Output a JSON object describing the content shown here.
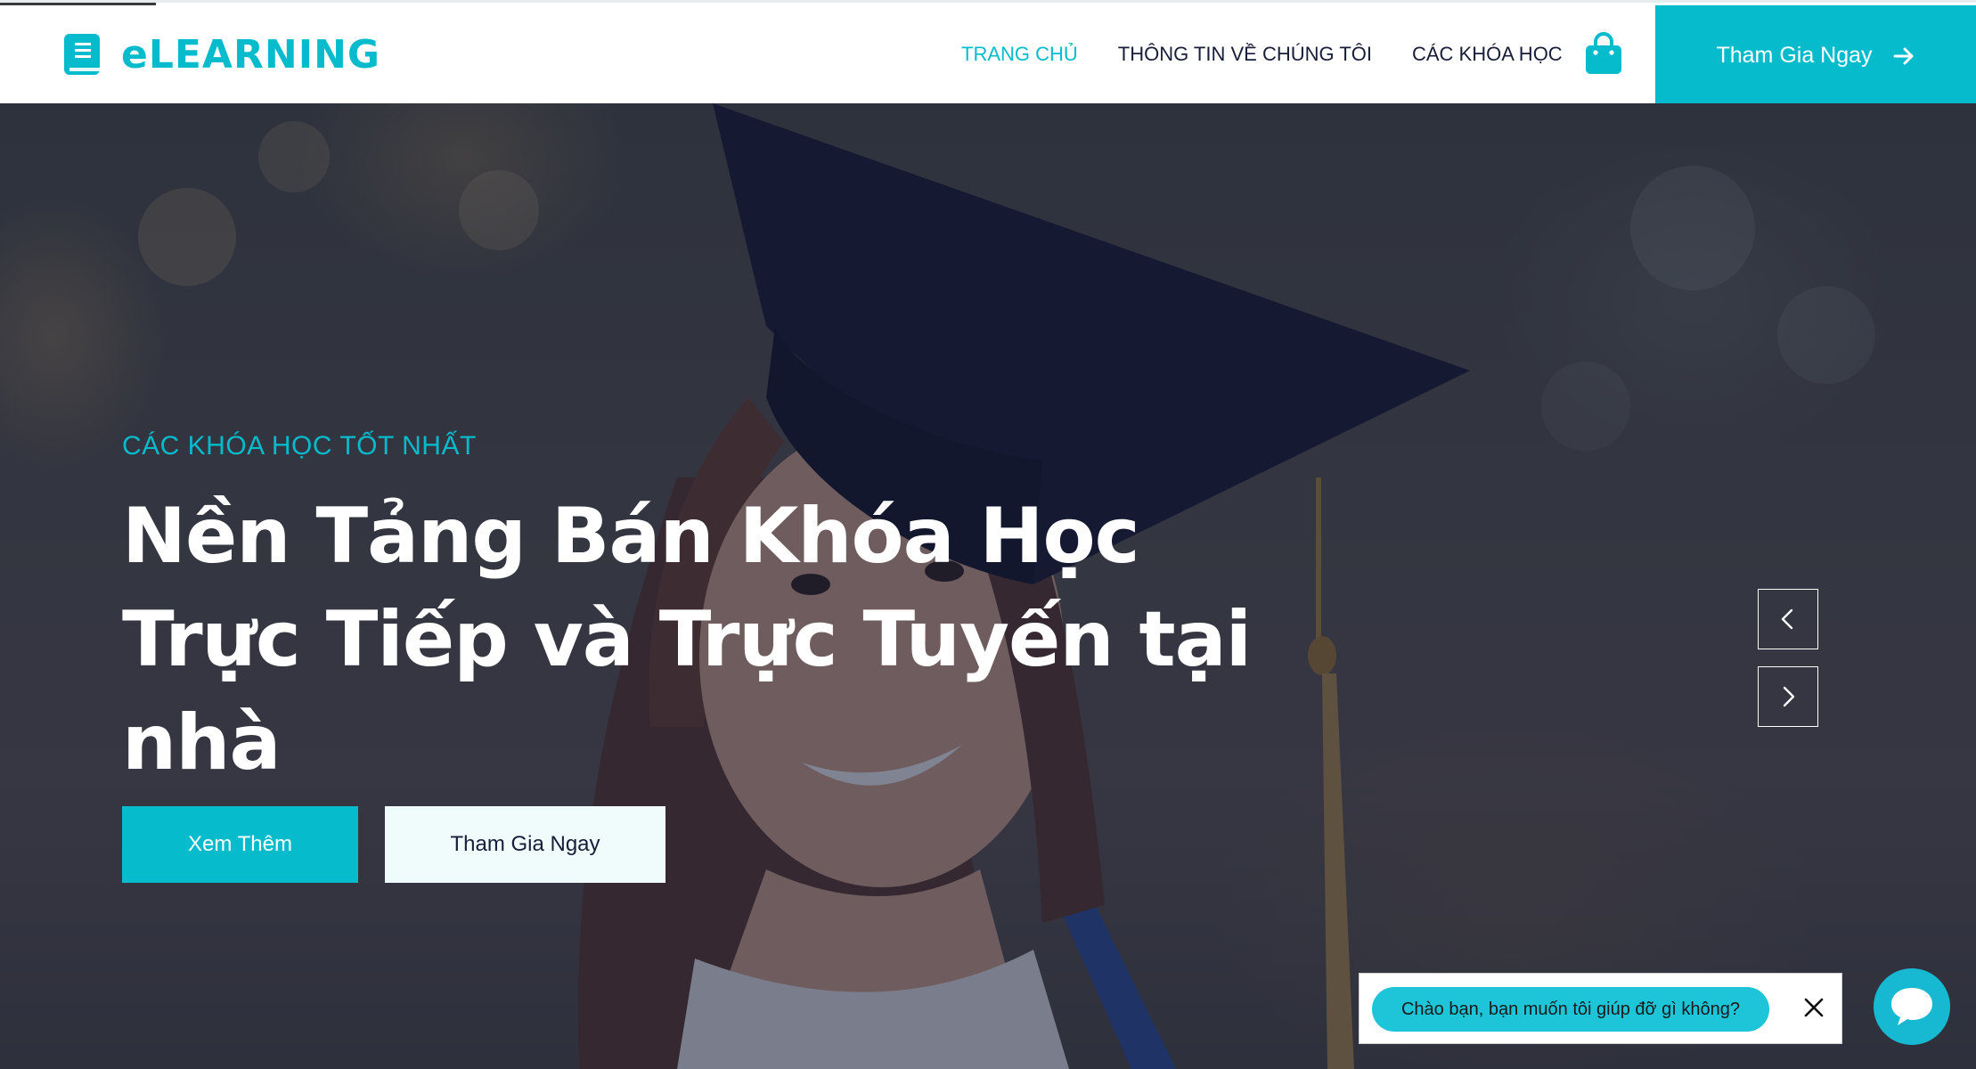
{
  "header": {
    "brand": "eLEARNING",
    "nav": [
      {
        "label": "TRANG CHỦ",
        "active": true
      },
      {
        "label": "THÔNG TIN VỀ CHÚNG TÔI",
        "active": false
      },
      {
        "label": "CÁC KHÓA HỌC",
        "active": false
      }
    ],
    "cart_icon": "shopping-bag-icon",
    "cta_label": "Tham Gia Ngay",
    "cta_icon": "arrow-right-icon"
  },
  "hero": {
    "eyebrow": "CÁC KHÓA HỌC TỐT NHẤT",
    "title": "Nền Tảng Bán Khóa Học Trực Tiếp và Trực Tuyến tại nhà",
    "primary_button": "Xem Thêm",
    "secondary_button": "Tham Gia Ngay",
    "prev_icon": "chevron-left-icon",
    "next_icon": "chevron-right-icon"
  },
  "chat": {
    "greeting": "Chào bạn, bạn muốn tôi giúp đỡ gì không?",
    "close_icon": "close-icon",
    "launcher_icon": "chat-bubble-icon"
  },
  "colors": {
    "accent": "#06bbcc",
    "dark": "#181d38",
    "light_button": "#f0fbfc"
  }
}
